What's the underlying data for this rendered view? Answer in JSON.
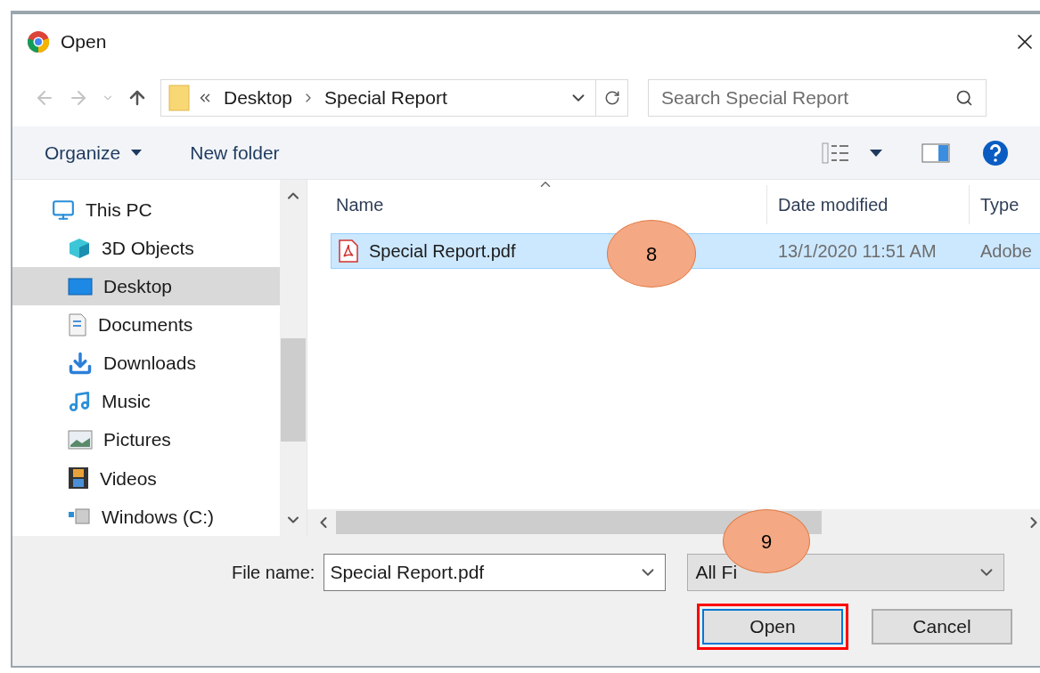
{
  "window": {
    "title": "Open"
  },
  "address": {
    "crumbs": [
      "Desktop",
      "Special Report"
    ]
  },
  "search": {
    "placeholder": "Search Special Report"
  },
  "toolbar": {
    "organize": "Organize",
    "new_folder": "New folder"
  },
  "sidebar": {
    "items": [
      {
        "label": "This PC",
        "kind": "pc",
        "selected": false,
        "children": [
          {
            "label": "3D Objects",
            "kind": "cube",
            "selected": false
          },
          {
            "label": "Desktop",
            "kind": "desktop",
            "selected": true
          },
          {
            "label": "Documents",
            "kind": "documents",
            "selected": false
          },
          {
            "label": "Downloads",
            "kind": "downloads",
            "selected": false
          },
          {
            "label": "Music",
            "kind": "music",
            "selected": false
          },
          {
            "label": "Pictures",
            "kind": "pictures",
            "selected": false
          },
          {
            "label": "Videos",
            "kind": "videos",
            "selected": false
          },
          {
            "label": "Windows (C:)",
            "kind": "drive",
            "selected": false
          }
        ]
      }
    ]
  },
  "columns": [
    "Name",
    "Date modified",
    "Type"
  ],
  "files": [
    {
      "name": "Special Report.pdf",
      "date": "13/1/2020 11:51 AM",
      "type": "Adobe",
      "selected": true
    }
  ],
  "file_name": {
    "label": "File name:",
    "value": "Special Report.pdf"
  },
  "filter": {
    "value": "All Fi"
  },
  "buttons": [
    {
      "label": "Open",
      "default": true,
      "highlighted": true
    },
    {
      "label": "Cancel",
      "default": false,
      "highlighted": false
    }
  ],
  "callouts": [
    {
      "label": "8"
    },
    {
      "label": "9"
    }
  ]
}
